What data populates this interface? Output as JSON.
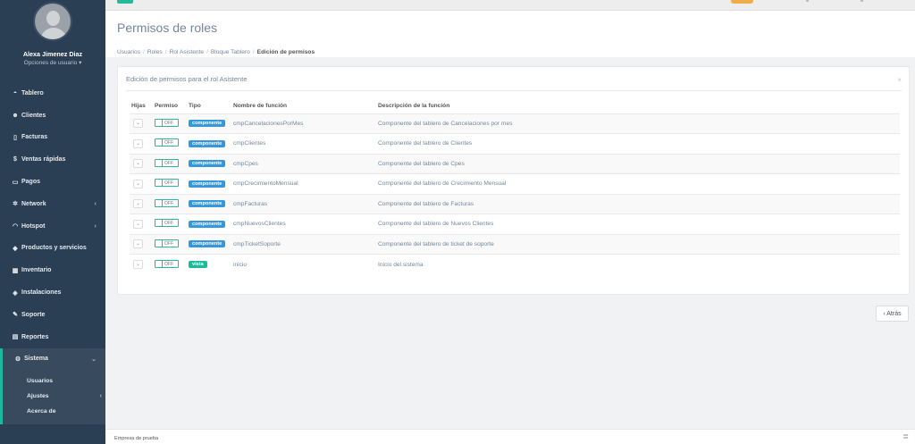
{
  "user": {
    "name": "Alexa Jimenez Diaz",
    "options_label": "Opciones de usuario ▾"
  },
  "sidebar": {
    "items": [
      {
        "label": "Tablero",
        "icon": "dashboard-icon",
        "glyph": "◓"
      },
      {
        "label": "Clientes",
        "icon": "users-icon",
        "glyph": "☻"
      },
      {
        "label": "Facturas",
        "icon": "file-icon",
        "glyph": "▯"
      },
      {
        "label": "Ventas rápidas",
        "icon": "dollar-icon",
        "glyph": "$"
      },
      {
        "label": "Pagos",
        "icon": "credit-card-icon",
        "glyph": "▭"
      },
      {
        "label": "Network",
        "icon": "network-icon",
        "glyph": "✲",
        "chevron": "‹"
      },
      {
        "label": "Hotspot",
        "icon": "wifi-icon",
        "glyph": "◠",
        "chevron": "‹"
      },
      {
        "label": "Productos y servicios",
        "icon": "tag-icon",
        "glyph": "◆"
      },
      {
        "label": "Inventario",
        "icon": "cubes-icon",
        "glyph": "▦"
      },
      {
        "label": "Instalaciones",
        "icon": "wrench-icon",
        "glyph": "◈"
      },
      {
        "label": "Soporte",
        "icon": "tool-icon",
        "glyph": "✎"
      },
      {
        "label": "Reportes",
        "icon": "book-icon",
        "glyph": "▤"
      }
    ],
    "active": {
      "label": "Sistema",
      "icon": "cogs-icon",
      "glyph": "⚙",
      "chevron": "⌄"
    },
    "sub_items": [
      {
        "label": "Usuarios"
      },
      {
        "label": "Ajustes",
        "chevron": "‹"
      },
      {
        "label": "Acerca de"
      }
    ]
  },
  "page": {
    "title": "Permisos de roles",
    "breadcrumb": [
      "Usuarios",
      "Roles",
      "Rol Asistente",
      "Bloque Tablero"
    ],
    "breadcrumb_current": "Edición de permisos"
  },
  "panel": {
    "title": "Edición de permisos para el rol Asistente",
    "close": "×",
    "columns": [
      "Hijas",
      "Permiso",
      "Tipo",
      "Nombre de función",
      "Descripción de la función"
    ],
    "rows": [
      {
        "expand": "⌄",
        "permiso": "OFF",
        "tipo": "componente",
        "nombre": "cmpCancelacionesPorMes",
        "descripcion": "Componente del tablero de Cancelaciones por mes"
      },
      {
        "expand": "⌄",
        "permiso": "OFF",
        "tipo": "componente",
        "nombre": "cmpClientes",
        "descripcion": "Componente del tablero de Clientes"
      },
      {
        "expand": "⌄",
        "permiso": "OFF",
        "tipo": "componente",
        "nombre": "cmpCpes",
        "descripcion": "Componente del tablero de Cpes"
      },
      {
        "expand": "⌄",
        "permiso": "OFF",
        "tipo": "componente",
        "nombre": "cmpCrecimientoMensual",
        "descripcion": "Componente del tablero de Crecimiento Mensual"
      },
      {
        "expand": "⌄",
        "permiso": "OFF",
        "tipo": "componente",
        "nombre": "cmpFacturas",
        "descripcion": "Componente del tablero de Facturas"
      },
      {
        "expand": "⌄",
        "permiso": "OFF",
        "tipo": "componente",
        "nombre": "cmpNuevosClientes",
        "descripcion": "Componente del tablero de Nuevos Clientes"
      },
      {
        "expand": "⌄",
        "permiso": "OFF",
        "tipo": "componente",
        "nombre": "cmpTicketSoporte",
        "descripcion": "Componente del tablero de ticket de soporte"
      },
      {
        "expand": "⌄",
        "permiso": "OFF",
        "tipo": "vista",
        "nombre": "inicio",
        "descripcion": "Inicio del sistema"
      }
    ]
  },
  "back_button": "‹ Atrás",
  "footer": {
    "text": "Empresa de prueba",
    "icon": "settings-icon",
    "glyph": "≣"
  },
  "colors": {
    "sidebar": "#2a3f54",
    "accent": "#1abb9c",
    "badge_componente": "#3498db",
    "badge_vista": "#1abc9c",
    "topbar_orange": "#f0ad4e"
  }
}
